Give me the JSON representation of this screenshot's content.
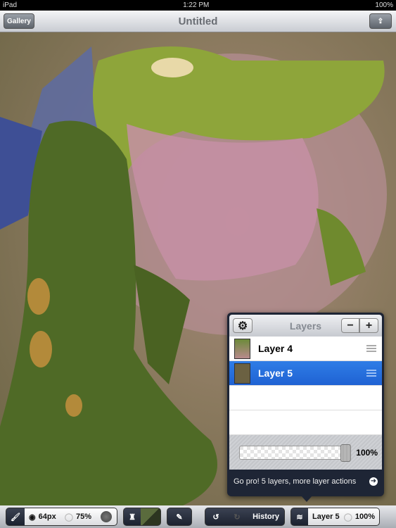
{
  "status": {
    "device": "iPad",
    "time": "1:22 PM",
    "battery": "100%"
  },
  "nav": {
    "gallery": "Gallery",
    "title": "Untitled",
    "share_icon": "share-icon"
  },
  "layers": {
    "title": "Layers",
    "items": [
      {
        "label": "Layer 4",
        "selected": false
      },
      {
        "label": "Layer 5",
        "selected": true
      }
    ],
    "opacity": "100%",
    "opacity_value": 100,
    "promo": "Go pro! 5 layers, more layer actions",
    "accent": "#2a72e0"
  },
  "toolbar": {
    "brush_size": "64px",
    "brush_opacity": "75%",
    "history": "History",
    "layer": "Layer 5",
    "layer_opacity": "100%",
    "color": "#3d4a2a"
  }
}
